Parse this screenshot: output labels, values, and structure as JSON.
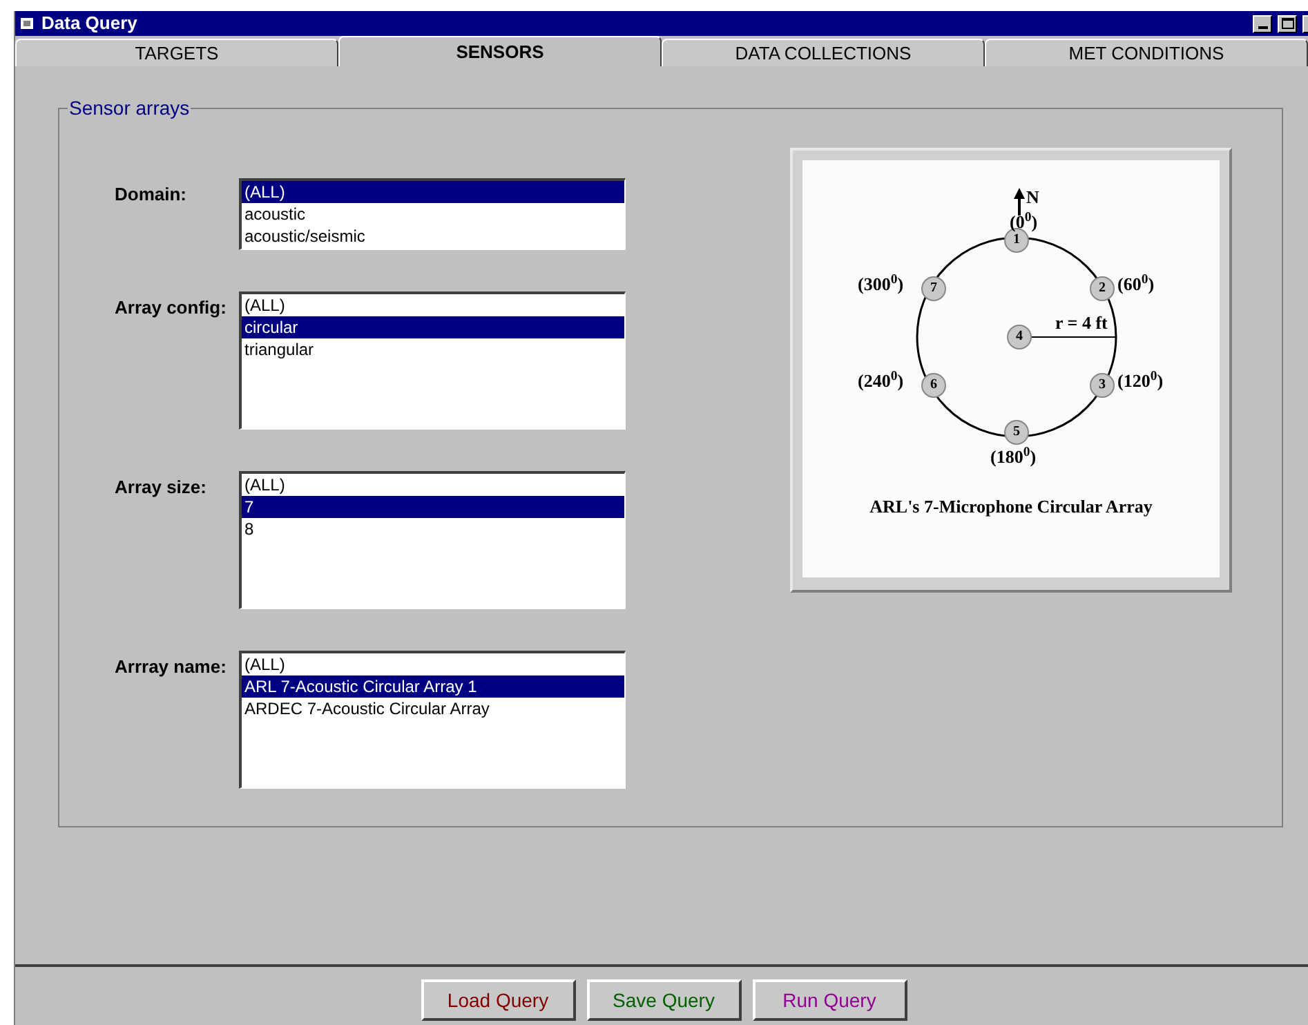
{
  "window": {
    "title": "Data Query"
  },
  "tabs": [
    {
      "label": "TARGETS",
      "selected": false
    },
    {
      "label": "SENSORS",
      "selected": true
    },
    {
      "label": "DATA COLLECTIONS",
      "selected": false
    },
    {
      "label": "MET CONDITIONS",
      "selected": false
    }
  ],
  "group": {
    "title": "Sensor arrays"
  },
  "lists": [
    {
      "label": "Domain:",
      "items": [
        {
          "text": "(ALL)",
          "selected": true
        },
        {
          "text": "acoustic",
          "selected": false
        },
        {
          "text": "acoustic/seismic",
          "selected": false
        }
      ]
    },
    {
      "label": "Array config:",
      "items": [
        {
          "text": "(ALL)",
          "selected": false
        },
        {
          "text": "circular",
          "selected": true
        },
        {
          "text": "triangular",
          "selected": false
        }
      ]
    },
    {
      "label": "Array size:",
      "items": [
        {
          "text": "(ALL)",
          "selected": false
        },
        {
          "text": "7",
          "selected": true
        },
        {
          "text": "8",
          "selected": false
        }
      ]
    },
    {
      "label": "Arrray name:",
      "items": [
        {
          "text": "(ALL)",
          "selected": false
        },
        {
          "text": "ARL 7-Acoustic Circular Array 1",
          "selected": true
        },
        {
          "text": "ARDEC 7-Acoustic Circular Array",
          "selected": false
        }
      ]
    }
  ],
  "diagram": {
    "north": "N",
    "radius_label": "r = 4 ft",
    "caption": "ARL's 7-Microphone Circular Array",
    "nodes": [
      {
        "number": "1",
        "angle": "(0$^{0}$)"
      },
      {
        "number": "7",
        "angle": "(300$^{0}$)"
      },
      {
        "number": "2",
        "angle": "(60$^{0}$)"
      },
      {
        "number": "4"
      },
      {
        "number": "6",
        "angle": "(240$^{0}$)"
      },
      {
        "number": "3",
        "angle": "(120$^{0}$)"
      },
      {
        "number": "5",
        "angle": "(180$^{0}$)"
      }
    ]
  },
  "buttons": [
    {
      "label": "Load Query",
      "color": "#800000"
    },
    {
      "label": "Save Query",
      "color": "#006000"
    },
    {
      "label": "Run Query",
      "color": "#900090"
    }
  ]
}
